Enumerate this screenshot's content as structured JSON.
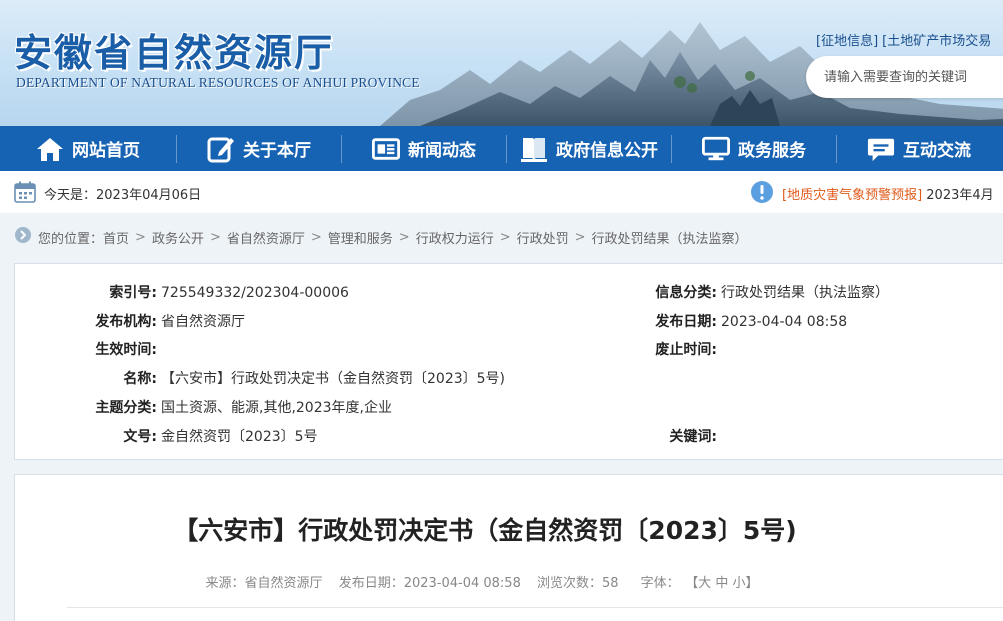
{
  "header": {
    "title": "安徽省自然资源厅",
    "subtitle": "DEPARTMENT OF NATURAL RESOURCES OF ANHUI PROVINCE",
    "top_links": [
      "[征地信息]",
      "[土地矿产市场交易"
    ],
    "search": {
      "placeholder": "请输入需要查询的关键词"
    }
  },
  "nav": [
    {
      "label": "网站首页",
      "icon": "home-icon"
    },
    {
      "label": "关于本厅",
      "icon": "edit-icon"
    },
    {
      "label": "新闻动态",
      "icon": "news-icon"
    },
    {
      "label": "政府信息公开",
      "icon": "book-icon"
    },
    {
      "label": "政务服务",
      "icon": "monitor-icon"
    },
    {
      "label": "互动交流",
      "icon": "chat-icon"
    }
  ],
  "datebar": {
    "today": "今天是：2023年04月06日",
    "alert_link": "[地质灾害气象预警预报]",
    "alert_text": " 2023年4月"
  },
  "breadcrumb": {
    "prefix": "您的位置：",
    "items": [
      "首页",
      "政务公开",
      "省自然资源厅",
      "管理和服务",
      "行政权力运行",
      "行政处罚",
      "行政处罚结果（执法监察）"
    ],
    "separator": ">"
  },
  "info": {
    "left": [
      {
        "label": "索引号:",
        "value": "725549332/202304-00006"
      },
      {
        "label": "发布机构:",
        "value": "省自然资源厅"
      },
      {
        "label": "生效时间:",
        "value": ""
      },
      {
        "label": "名称:",
        "value": "【六安市】行政处罚决定书（金自然资罚〔2023〕5号)"
      },
      {
        "label": "主题分类:",
        "value": "国土资源、能源,其他,2023年度,企业"
      },
      {
        "label": "文号:",
        "value": "金自然资罚〔2023〕5号"
      }
    ],
    "right": [
      {
        "label": "信息分类:",
        "value": "行政处罚结果（执法监察）"
      },
      {
        "label": "发布日期:",
        "value": "2023-04-04 08:58"
      },
      {
        "label": "废止时间:",
        "value": ""
      },
      {
        "label": "关键词:",
        "value": ""
      }
    ]
  },
  "article": {
    "title": "【六安市】行政处罚决定书（金自然资罚〔2023〕5号)",
    "source": "来源：省自然资源厅",
    "date": "发布日期：2023-04-04 08:58",
    "views": "浏览次数：58",
    "font_label": "字体：",
    "font_sizes": "【大 中 小】"
  },
  "colors": {
    "nav_bg": "#1662b3",
    "title_blue": "#1a5ea8",
    "alert": "#e05a1a"
  }
}
